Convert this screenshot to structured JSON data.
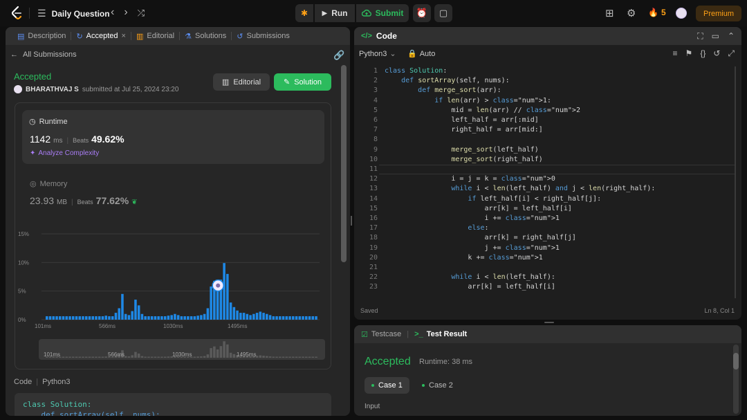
{
  "topbar": {
    "title": "Daily Question",
    "run_label": "Run",
    "submit_label": "Submit",
    "streak": "5",
    "premium_label": "Premium"
  },
  "left_tabs": [
    {
      "label": "Description"
    },
    {
      "label": "Accepted"
    },
    {
      "label": "Editorial"
    },
    {
      "label": "Solutions"
    },
    {
      "label": "Submissions"
    }
  ],
  "submission": {
    "back_label": "All Submissions",
    "status": "Accepted",
    "user": "BHARATHVAJ S",
    "submitted_text": "submitted at Jul 25, 2024 23:20",
    "editorial_btn": "Editorial",
    "solution_btn": "Solution"
  },
  "runtime": {
    "label": "Runtime",
    "value": "1142",
    "unit": "ms",
    "beats_label": "Beats",
    "beats": "49.62%",
    "analyze": "Analyze Complexity"
  },
  "memory": {
    "label": "Memory",
    "value": "23.93",
    "unit": "MB",
    "beats_label": "Beats",
    "beats": "77.62%"
  },
  "chart_data": {
    "type": "bar",
    "yticks": [
      "15%",
      "10%",
      "5%",
      "0%"
    ],
    "ylim": [
      0,
      15
    ],
    "xticks": [
      "101ms",
      "566ms",
      "1030ms",
      "1495ms"
    ],
    "mini_xticks": [
      "101ms",
      "566ms",
      "1030ms",
      "1495ms"
    ],
    "values": [
      0.6,
      0.6,
      0.6,
      0.6,
      0.6,
      0.6,
      0.6,
      0.6,
      0.6,
      0.6,
      0.6,
      0.6,
      0.6,
      0.6,
      0.6,
      0.6,
      0.6,
      0.6,
      0.7,
      0.6,
      0.6,
      1.2,
      2.0,
      4.5,
      1.0,
      0.8,
      1.5,
      3.5,
      2.5,
      1.0,
      0.6,
      0.6,
      0.6,
      0.6,
      0.6,
      0.6,
      0.6,
      0.7,
      0.8,
      1.0,
      0.8,
      0.6,
      0.6,
      0.6,
      0.6,
      0.6,
      0.7,
      0.8,
      1.0,
      2.0,
      5.8,
      6.8,
      5.0,
      7.0,
      9.9,
      8.0,
      3.0,
      2.2,
      1.6,
      1.2,
      1.2,
      1.0,
      0.8,
      1.0,
      1.2,
      1.4,
      1.2,
      1.0,
      0.8,
      0.6,
      0.6,
      0.6,
      0.6,
      0.6,
      0.6,
      0.6,
      0.6,
      0.6,
      0.6,
      0.6,
      0.6,
      0.6,
      0.6
    ],
    "highlight_index": 52
  },
  "code_preview": {
    "label": "Code",
    "lang": "Python3",
    "first_line": "class Solution:",
    "second_line": "    def sortArray(self, nums):"
  },
  "editor": {
    "title": "Code",
    "language": "Python3",
    "mode": "Auto",
    "saved": "Saved",
    "cursor": "Ln 8, Col 1",
    "line_numbers": [
      "1",
      "2",
      "3",
      "4",
      "5",
      "6",
      "7",
      "8",
      "9",
      "10",
      "11",
      "12",
      "13",
      "14",
      "15",
      "16",
      "17",
      "18",
      "19",
      "20",
      "21",
      "22",
      "23"
    ],
    "lines": [
      "class Solution:",
      "    def sortArray(self, nums):",
      "        def merge_sort(arr):",
      "            if len(arr) > 1:",
      "                mid = len(arr) // 2",
      "                left_half = arr[:mid]",
      "                right_half = arr[mid:]",
      "",
      "                merge_sort(left_half)",
      "                merge_sort(right_half)",
      "",
      "                i = j = k = 0",
      "                while i < len(left_half) and j < len(right_half):",
      "                    if left_half[i] < right_half[j]:",
      "                        arr[k] = left_half[i]",
      "                        i += 1",
      "                    else:",
      "                        arr[k] = right_half[j]",
      "                        j += 1",
      "                    k += 1",
      "",
      "                while i < len(left_half):",
      "                    arr[k] = left_half[i]"
    ]
  },
  "result": {
    "tab_testcase": "Testcase",
    "tab_result": "Test Result",
    "status": "Accepted",
    "runtime": "Runtime: 38 ms",
    "case1": "Case 1",
    "case2": "Case 2",
    "input_label": "Input"
  },
  "colors": {
    "accent_green": "#2cbb5d",
    "bar_blue": "#1e88e5",
    "premium_orange": "#ffa116"
  }
}
